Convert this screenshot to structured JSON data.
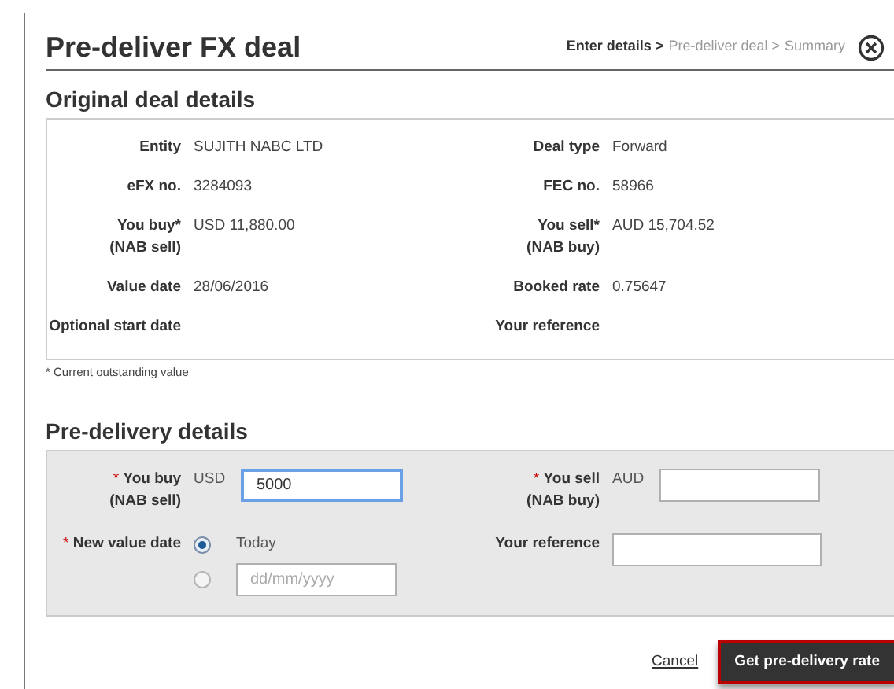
{
  "title": "Pre-deliver FX deal",
  "breadcrumb": [
    {
      "label": "Enter details",
      "separator": ">",
      "selected": true
    },
    {
      "label": "Pre-deliver deal",
      "separator": ">",
      "selected": false
    },
    {
      "label": "Summary",
      "selected": false
    }
  ],
  "original": {
    "heading": "Original deal details",
    "rows": [
      [
        {
          "label": "Entity",
          "value": "SUJITH NABC LTD"
        },
        {
          "label": "Deal type",
          "value": "Forward"
        }
      ],
      [
        {
          "label": "eFX no.",
          "value": "3284093"
        },
        {
          "label": "FEC no.",
          "value": "58966"
        }
      ],
      [
        {
          "label": "You buy*",
          "sublabel": "(NAB sell)",
          "value": "USD 11,880.00"
        },
        {
          "label": "You sell*",
          "sublabel": "(NAB buy)",
          "value": "AUD 15,704.52"
        }
      ],
      [
        {
          "label": "Value date",
          "value": "28/06/2016"
        },
        {
          "label": "Booked rate",
          "value": "0.75647"
        }
      ],
      [
        {
          "label": "Optional start date"
        },
        {
          "label": "Your reference"
        }
      ]
    ],
    "footnote": "* Current outstanding value"
  },
  "predelivery": {
    "heading": "Pre-delivery details",
    "buy": {
      "mark": "*",
      "label": "You buy",
      "sublabel": "(NAB sell)",
      "currency": "USD",
      "value": "5000",
      "focused": true
    },
    "sell": {
      "mark": "*",
      "label": "You sell",
      "sublabel": "(NAB buy)",
      "currency": "AUD",
      "focused": false
    },
    "value_date": {
      "mark": "*",
      "label": "New value date",
      "options": [
        {
          "label": "Today",
          "selected": true
        },
        {
          "placeholder": "dd/mm/yyyy",
          "selected": false
        }
      ]
    },
    "reference": {
      "label": "Your reference"
    }
  },
  "actions": {
    "cancel": "Cancel",
    "submit": "Get pre-delivery rate"
  }
}
